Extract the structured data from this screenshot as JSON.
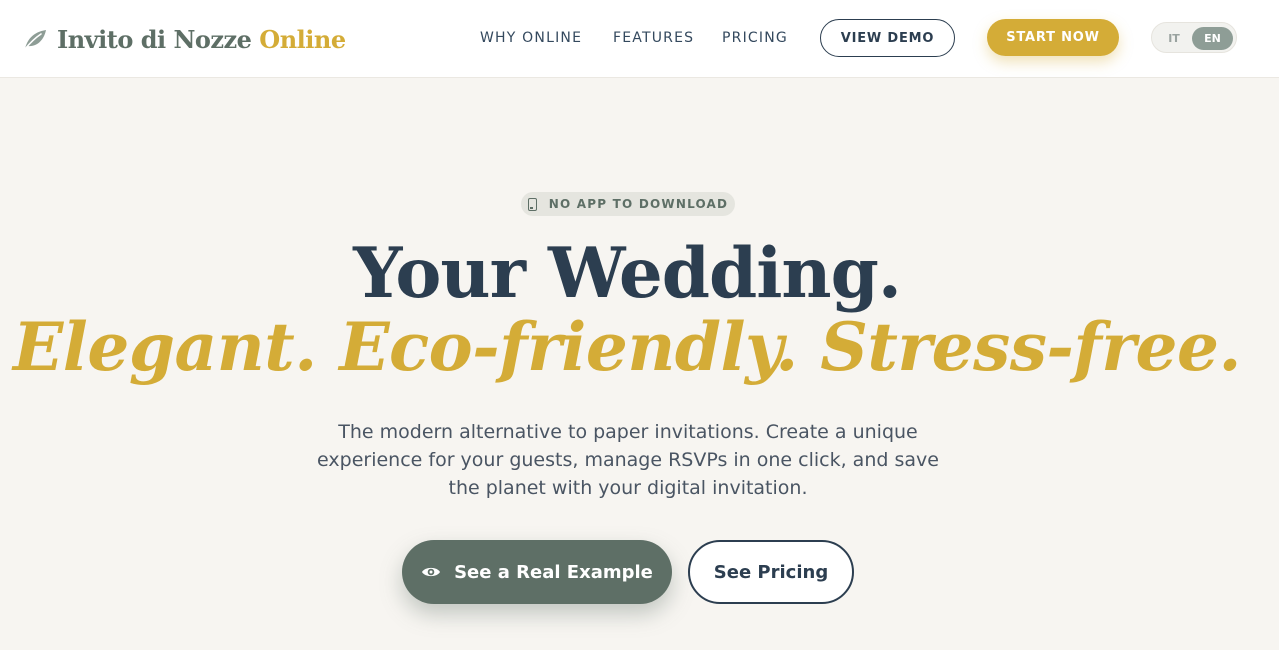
{
  "brand": {
    "name_main": "Invito di Nozze",
    "name_accent": "Online",
    "icon": "leaf-icon"
  },
  "nav": {
    "links": [
      {
        "label": "WHY ONLINE"
      },
      {
        "label": "FEATURES"
      },
      {
        "label": "PRICING"
      }
    ],
    "view_demo": "VIEW DEMO",
    "start_now": "START NOW",
    "languages": {
      "it": "IT",
      "en": "EN",
      "active": "EN"
    }
  },
  "hero": {
    "badge": {
      "icon": "phone-icon",
      "text": "NO APP TO DOWNLOAD"
    },
    "title_line1": "Your Wedding.",
    "title_line2": "Elegant. Eco-friendly. Stress-free.",
    "subtitle": "The modern alternative to paper invitations. Create a unique experience for your guests, manage RSVPs in one click, and save the planet with your digital invitation.",
    "primary_button": {
      "icon": "eye-icon",
      "label": "See a Real Example"
    },
    "secondary_button": {
      "label": "See Pricing"
    }
  },
  "colors": {
    "accent_gold": "#d4ac37",
    "sage": "#5e6f66",
    "navy": "#2c3e50",
    "background": "#f7f5f1"
  }
}
